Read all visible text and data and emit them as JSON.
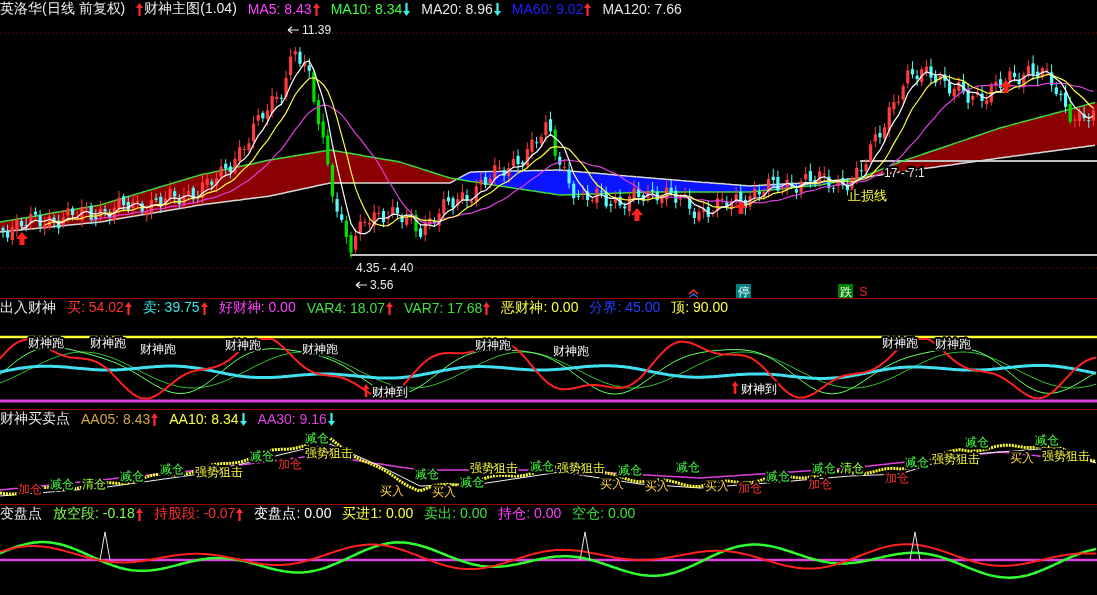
{
  "main_panel": {
    "title": "英洛华(日线 前复权)",
    "indicator": "财神主图(1.04)",
    "values": [
      {
        "label": "MA5: 8.43",
        "color": "#ff40ff",
        "rising": true
      },
      {
        "label": "MA10: 8.34",
        "color": "#40ff40",
        "rising": false
      },
      {
        "label": "MA20: 8.96",
        "color": "#e6e6e6",
        "rising": false
      },
      {
        "label": "MA60: 9.02",
        "color": "#2020ff",
        "rising": true
      },
      {
        "label": "MA120: 7.66",
        "color": "#e6e6e6"
      }
    ],
    "annotations": [
      {
        "kind": "high",
        "text": "11.39"
      },
      {
        "kind": "range",
        "text": "4.35 - 4.40"
      },
      {
        "kind": "low",
        "text": "3.56"
      },
      {
        "kind": "range",
        "text": "17 - 7.1"
      },
      {
        "kind": "stop_line",
        "text": "止损线"
      }
    ],
    "signals": [
      {
        "kind": "halt",
        "text": "停"
      },
      {
        "kind": "fall",
        "text": "跌"
      },
      {
        "kind": "sell",
        "text": "S"
      }
    ]
  },
  "entry_panel": {
    "title": "出入财神",
    "values": [
      {
        "label": "买: 54.02",
        "color": "#ff3030",
        "rising": true
      },
      {
        "label": "卖: 39.75",
        "color": "#40e0e0",
        "rising": true
      },
      {
        "label": "好财神: 0.00",
        "color": "#ff40ff"
      },
      {
        "label": "VAR4: 18.07",
        "color": "#40e040",
        "rising": true
      },
      {
        "label": "VAR7: 17.68",
        "color": "#40e040",
        "rising": true
      },
      {
        "label": "恶财神: 0.00",
        "color": "#ffff40"
      },
      {
        "label": "分界: 45.00",
        "color": "#2040ff"
      },
      {
        "label": "顶: 90.00",
        "color": "#ffff40"
      }
    ],
    "signals": [
      {
        "kind": "run",
        "text": "财神跑"
      },
      {
        "kind": "run",
        "text": "财神跑"
      },
      {
        "kind": "run",
        "text": "财神跑"
      },
      {
        "kind": "run",
        "text": "财神跑"
      },
      {
        "kind": "run",
        "text": "财神跑"
      },
      {
        "kind": "arrive",
        "text": "财神到"
      },
      {
        "kind": "run",
        "text": "财神跑"
      },
      {
        "kind": "run",
        "text": "财神跑"
      },
      {
        "kind": "arrive",
        "text": "财神到"
      },
      {
        "kind": "run",
        "text": "财神跑"
      },
      {
        "kind": "run",
        "text": "财神跑"
      }
    ]
  },
  "trade_panel": {
    "title": "财神买卖点",
    "values": [
      {
        "label": "AA05: 8.43",
        "color": "#d4a640",
        "rising": true
      },
      {
        "label": "AA10: 8.34",
        "color": "#ffff40",
        "rising": false
      },
      {
        "label": "AA30: 9.16",
        "color": "#e040e0",
        "rising": false
      }
    ],
    "signals": [
      {
        "kind": "add",
        "text": "加仓"
      },
      {
        "kind": "reduce",
        "text": "减仓"
      },
      {
        "kind": "clear",
        "text": "清仓"
      },
      {
        "kind": "reduce",
        "text": "减仓"
      },
      {
        "kind": "reduce",
        "text": "减仓"
      },
      {
        "kind": "snipe",
        "text": "强势狙击"
      },
      {
        "kind": "reduce",
        "text": "减仓"
      },
      {
        "kind": "add",
        "text": "加仓"
      },
      {
        "kind": "reduce",
        "text": "减仓"
      },
      {
        "kind": "snipe",
        "text": "强势狙击"
      },
      {
        "kind": "buy",
        "text": "买入"
      },
      {
        "kind": "reduce",
        "text": "减仓"
      },
      {
        "kind": "buy",
        "text": "买入"
      },
      {
        "kind": "reduce",
        "text": "减仓"
      },
      {
        "kind": "snipe",
        "text": "强势狙击"
      },
      {
        "kind": "reduce",
        "text": "减仓"
      },
      {
        "kind": "snipe",
        "text": "强势狙击"
      },
      {
        "kind": "buy",
        "text": "买入"
      },
      {
        "kind": "reduce",
        "text": "减仓"
      },
      {
        "kind": "buy",
        "text": "买入"
      },
      {
        "kind": "reduce",
        "text": "减仓"
      },
      {
        "kind": "buy",
        "text": "买入"
      },
      {
        "kind": "add",
        "text": "加仓"
      },
      {
        "kind": "reduce",
        "text": "减仓"
      },
      {
        "kind": "add",
        "text": "加仓"
      },
      {
        "kind": "reduce",
        "text": "减仓"
      },
      {
        "kind": "clear",
        "text": "清仓"
      },
      {
        "kind": "add",
        "text": "加仓"
      },
      {
        "kind": "reduce",
        "text": "减仓"
      },
      {
        "kind": "snipe",
        "text": "强势狙击"
      },
      {
        "kind": "reduce",
        "text": "减仓"
      },
      {
        "kind": "buy",
        "text": "买入"
      },
      {
        "kind": "reduce",
        "text": "减仓"
      },
      {
        "kind": "snipe",
        "text": "强势狙击"
      }
    ]
  },
  "turn_panel": {
    "title": "变盘点",
    "values": [
      {
        "label": "放空段: -0.18",
        "color": "#80ff40",
        "rising": true
      },
      {
        "label": "持股段: -0.07",
        "color": "#ff3030",
        "rising": true
      },
      {
        "label": "变盘点: 0.00",
        "color": "#ffffff"
      },
      {
        "label": "买进1: 0.00",
        "color": "#ffff40"
      },
      {
        "label": "卖出: 0.00",
        "color": "#40e040"
      },
      {
        "label": "持仓: 0.00",
        "color": "#ff40ff"
      },
      {
        "label": "空仓: 0.00",
        "color": "#40e040"
      }
    ]
  }
}
